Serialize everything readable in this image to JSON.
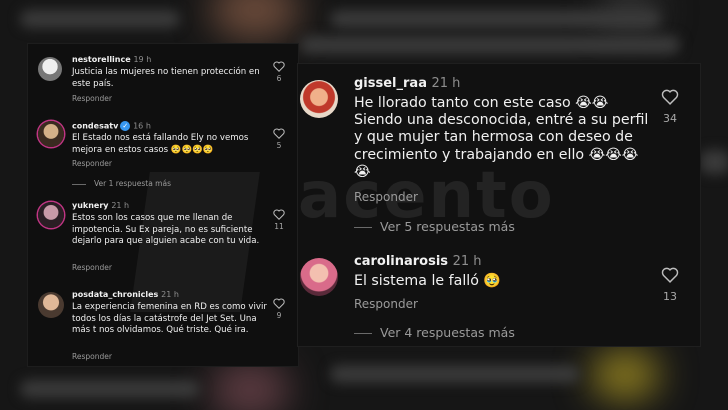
{
  "left": {
    "comments": [
      {
        "user": "nestorellince",
        "time": "19 h",
        "text": "Justicia las mujeres no tienen protección en este país.",
        "reply": "Responder",
        "likes": "6",
        "avatar_colors": [
          "#e8e8e8",
          "#6b6b6b"
        ]
      },
      {
        "user": "condesatv",
        "verified": "✓",
        "time": "16 h",
        "text": "El Estado  nos está fallando Ely no vemos mejora en estos casos 🥺🥺🥺🥺",
        "reply": "Responder",
        "likes": "5",
        "more": "Ver 1 respuesta más",
        "avatar_colors": [
          "#c9a57a",
          "#3a2a20"
        ]
      },
      {
        "user": "yuknery",
        "time": "21 h",
        "text": "Estos son los casos que me llenan de impotencia. Su Ex pareja, no es suficiente dejarlo para que alguien acabe con tu vida.",
        "reply": "Responder",
        "likes": "11",
        "avatar_colors": [
          "#b87a8e",
          "#2a1e24"
        ]
      },
      {
        "user": "posdata_chronicles",
        "time": "21 h",
        "text": "La experiencia femenina en RD es como vivir todos los días la catástrofe del Jet Set. Una más t nos olvidamos. Qué triste. Qué ira.",
        "reply": "Responder",
        "likes": "9",
        "avatar_colors": [
          "#d8b090",
          "#4a3a30"
        ]
      }
    ]
  },
  "right": {
    "comments": [
      {
        "user": "gissel_raa",
        "time": "21 h",
        "text": "He llorado tanto con este caso 😭😭 Siendo una desconocida, entré a su perfil y que mujer tan hermosa con deseo de crecimiento y trabajando en ello 😭😭😭😭",
        "reply": "Responder",
        "likes": "34",
        "more": "Ver 5 respuestas más",
        "avatar_colors": [
          "#e9a27a",
          "#c0392b"
        ]
      },
      {
        "user": "carolinarosis",
        "time": "21 h",
        "text": "El sistema le falló 🥹",
        "reply": "Responder",
        "likes": "13",
        "more": "Ver 4 respuestas más",
        "avatar_colors": [
          "#d96b8a",
          "#5a2a3a"
        ]
      }
    ]
  },
  "watermark": "acento"
}
